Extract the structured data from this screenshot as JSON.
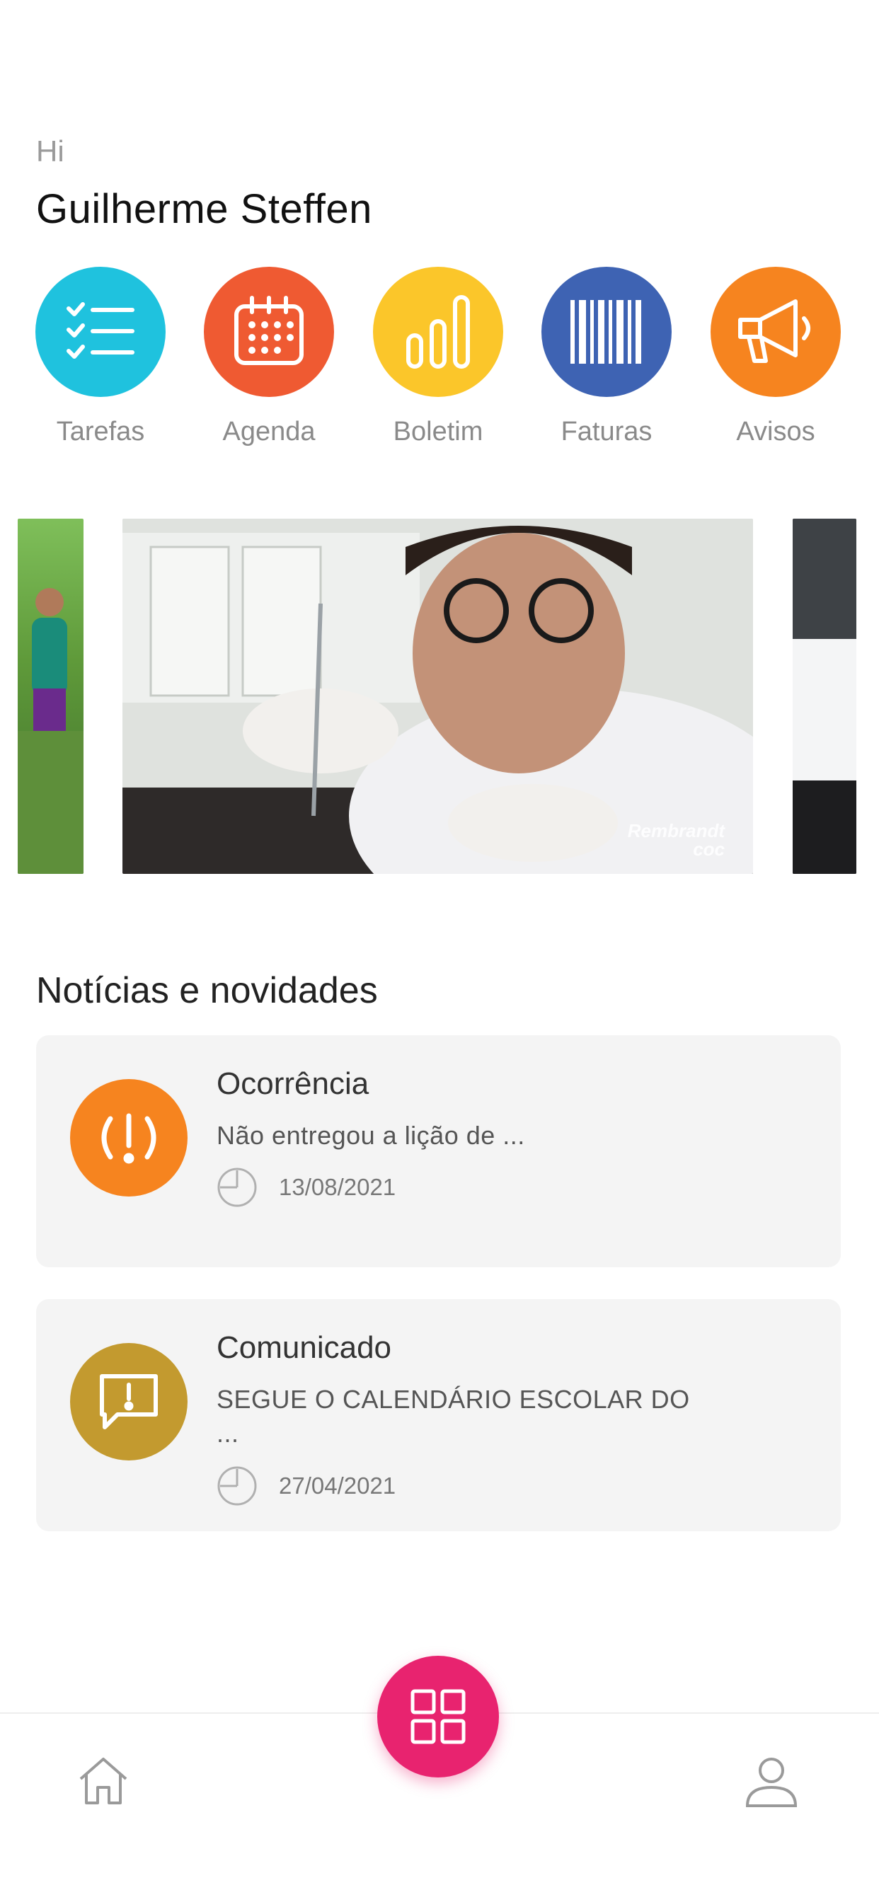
{
  "greeting": {
    "hi": "Hi",
    "name": "Guilherme Steffen"
  },
  "shortcuts": [
    {
      "label": "Tarefas",
      "icon": "checklist-icon",
      "color": "#1fc2de"
    },
    {
      "label": "Agenda",
      "icon": "calendar-icon",
      "color": "#ef5a32"
    },
    {
      "label": "Boletim",
      "icon": "bar-chart-icon",
      "color": "#fbc62a"
    },
    {
      "label": "Faturas",
      "icon": "barcode-icon",
      "color": "#3e63b3"
    },
    {
      "label": "Avisos",
      "icon": "megaphone-icon",
      "color": "#f6841f"
    }
  ],
  "carousel": {
    "watermark_line1": "Rembrandt",
    "watermark_line2": "coc"
  },
  "news": {
    "title": "Notícias e novidades",
    "items": [
      {
        "type": "Ocorrência",
        "text": "Não entregou a lição de ...",
        "date": "13/08/2021",
        "icon": "alert-icon",
        "color": "#f6841f"
      },
      {
        "type": "Comunicado",
        "text": "SEGUE O CALENDÁRIO ESCOLAR DO ...",
        "date": "27/04/2021",
        "icon": "message-alert-icon",
        "color": "#c39a2f"
      }
    ]
  },
  "bottom_nav": {
    "home_icon": "home-icon",
    "menu_icon": "grid-icon",
    "profile_icon": "user-icon",
    "fab_color": "#e8236f"
  }
}
